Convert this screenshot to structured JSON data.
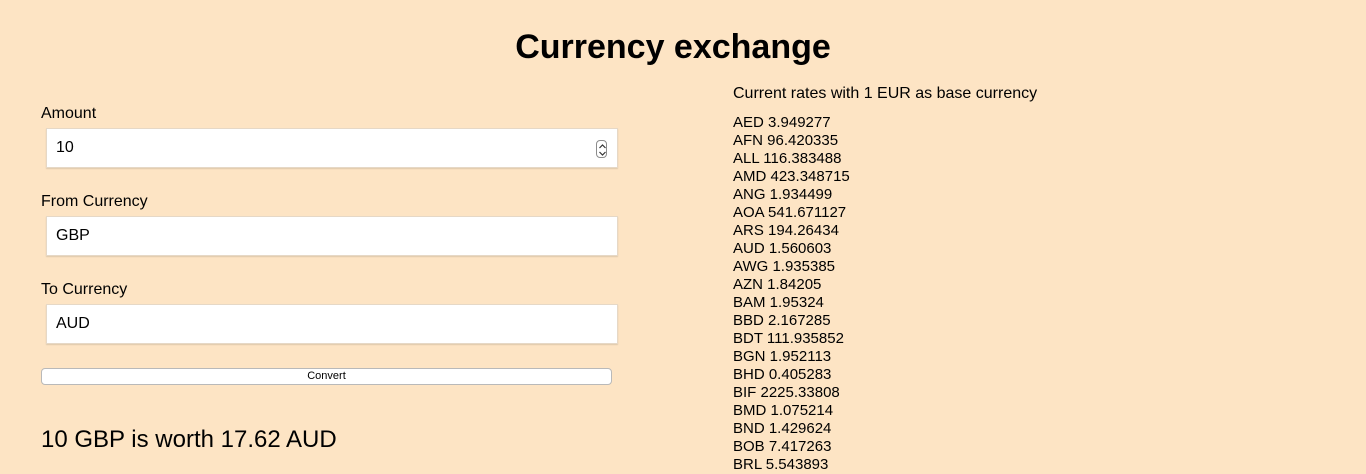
{
  "page": {
    "title": "Currency exchange"
  },
  "form": {
    "amount": {
      "label": "Amount",
      "value": "10"
    },
    "from_currency": {
      "label": "From Currency",
      "value": "GBP"
    },
    "to_currency": {
      "label": "To Currency",
      "value": "AUD"
    },
    "convert_label": "Convert"
  },
  "result": {
    "text": "10 GBP is worth 17.62 AUD"
  },
  "rates": {
    "heading": "Current rates with 1 EUR as base currency",
    "items": [
      "AED 3.949277",
      "AFN 96.420335",
      "ALL 116.383488",
      "AMD 423.348715",
      "ANG 1.934499",
      "AOA 541.671127",
      "ARS 194.26434",
      "AUD 1.560603",
      "AWG 1.935385",
      "AZN 1.84205",
      "BAM 1.95324",
      "BBD 2.167285",
      "BDT 111.935852",
      "BGN 1.952113",
      "BHD 0.405283",
      "BIF 2225.33808",
      "BMD 1.075214",
      "BND 1.429624",
      "BOB 7.417263",
      "BRL 5.543893"
    ]
  }
}
